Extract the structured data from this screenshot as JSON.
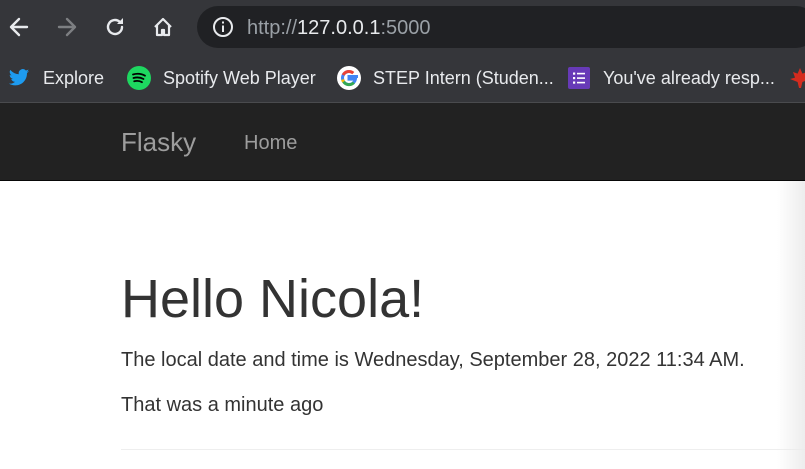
{
  "browser": {
    "url_scheme": "http://",
    "url_host": "127.0.0.1",
    "url_port": ":5000",
    "nav_icons": [
      "back-arrow-icon",
      "forward-arrow-icon",
      "reload-icon",
      "home-icon",
      "info-icon"
    ],
    "bookmarks": [
      {
        "label": "Explore",
        "icon": "twitter-icon",
        "color": "#1d9bf0"
      },
      {
        "label": "Spotify Web Player",
        "icon": "spotify-icon",
        "color": "#1ed760"
      },
      {
        "label": "STEP Intern (Studen...",
        "icon": "google-icon",
        "color": "#4285f4"
      },
      {
        "label": "You've already resp...",
        "icon": "google-forms-icon",
        "color": "#673ab7"
      }
    ]
  },
  "navbar": {
    "brand": "Flasky",
    "home_label": "Home",
    "background": "#222222"
  },
  "content": {
    "heading": "Hello Nicola!",
    "datetime_text": "The local date and time is Wednesday, September 28, 2022 11:34 AM.",
    "relative_text": "That was a minute ago"
  }
}
